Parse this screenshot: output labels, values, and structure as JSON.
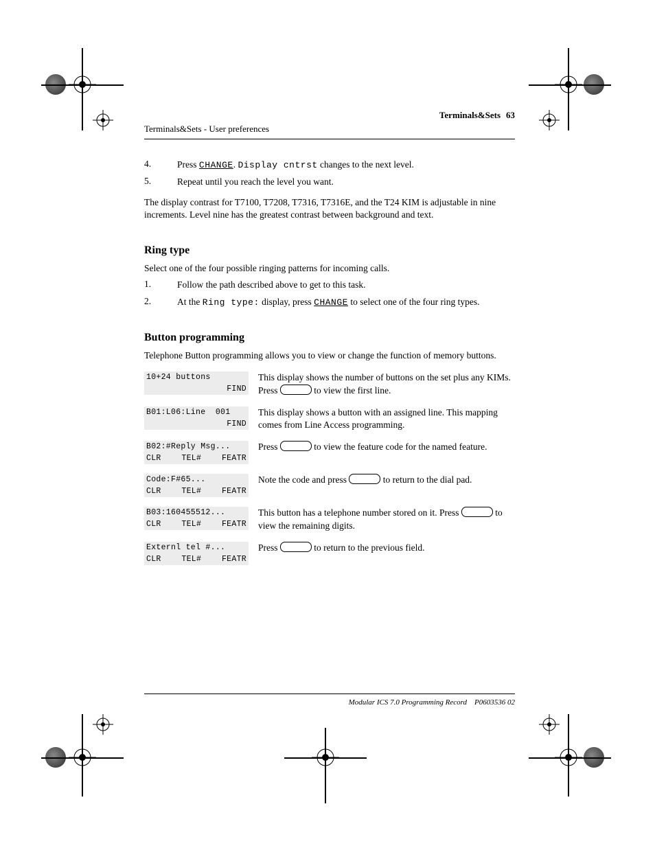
{
  "header": {
    "breadcrumb": "Terminals&Sets - User preferences",
    "page_title": "Terminals&Sets",
    "page_num": "63"
  },
  "contrast": {
    "step_num": "4.",
    "pre": "Press ",
    "change": "CHANGE",
    "mid": ". ",
    "after_label": "Display cntrst",
    "post": " changes to the next level.",
    "repeat_num": "5.",
    "repeat": "Repeat until you reach the level you want.",
    "levels": "The display contrast for T7100, T7208, T7316, T7316E, and the T24 KIM is adjustable in nine increments. Level nine has the greatest contrast between background and text."
  },
  "ring": {
    "title": "Ring type",
    "intro": "Select one of the four possible ringing patterns for incoming calls.",
    "step1_num": "1.",
    "step1": "Follow the path described above to get to this task.",
    "step2_num": "2.",
    "pre": "At the ",
    "label": "Ring type:",
    "mid": " display, press ",
    "change": "CHANGE",
    "post": " to select one of the four ring types."
  },
  "btnprog": {
    "title": "Button programming",
    "intro": "Telephone Button programming allows you to view or change the function of memory buttons.",
    "screens": [
      {
        "id": "buttons",
        "line1": "10+24 buttons",
        "sk_left": "",
        "sk_mid": "",
        "sk_right": "FIND",
        "desc_pre": "This display shows the number of buttons on the set plus any KIMs. Press ",
        "desc_post": " to view the first line."
      },
      {
        "id": "b01",
        "line1": "B01:L06:Line  001",
        "sk_left": "",
        "sk_mid": "",
        "sk_right": "FIND",
        "desc": "This display shows a button with an assigned line. This mapping comes from Line Access programming."
      },
      {
        "id": "b02",
        "line1": "B02:#Reply Msg...",
        "sk_left": "CLR",
        "sk_mid": "TEL#",
        "sk_right": "FEATR",
        "pill": true,
        "desc_pre": "Press ",
        "desc_post": " to view the feature code for the named feature."
      },
      {
        "id": "code",
        "line1": "Code:F#65...",
        "sk_left": "CLR",
        "sk_mid": "TEL#",
        "sk_right": "FEATR",
        "pill": true,
        "desc_pre": "Note the code and press ",
        "desc_post": " to return to the dial pad."
      },
      {
        "id": "b03",
        "line1": "B03:160455512...",
        "sk_left": "CLR",
        "sk_mid": "TEL#",
        "sk_right": "FEATR",
        "pill": true,
        "desc_pre": "This button has a telephone number stored on it. Press ",
        "desc_post": " to view the remaining digits."
      },
      {
        "id": "ext",
        "line1": "Externl tel #...",
        "sk_left": "CLR",
        "sk_mid": "TEL#",
        "sk_right": "FEATR",
        "pill": true,
        "desc_pre": "Press ",
        "desc_post": " to return to the previous field."
      }
    ]
  },
  "footer": {
    "text": "Modular ICS 7.0 Programming Record",
    "pn": "P0603536   02"
  }
}
